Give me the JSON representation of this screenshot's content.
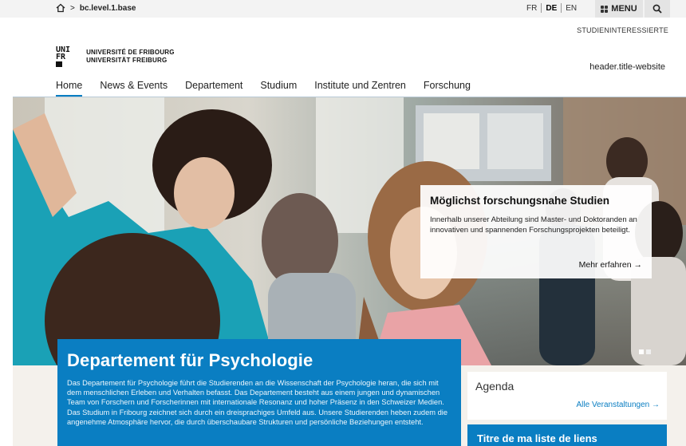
{
  "topbar": {
    "breadcrumb_sep": ">",
    "breadcrumb": "bc.level.1.base",
    "languages": [
      {
        "code": "FR",
        "active": false
      },
      {
        "code": "DE",
        "active": true
      },
      {
        "code": "EN",
        "active": false
      }
    ],
    "menu_label": "MENU",
    "icons": {
      "home": "home-icon",
      "menu": "grid-icon",
      "search": "search-icon"
    }
  },
  "header": {
    "audience_link": "STUDIENINTERESSIERTE",
    "logo_lines": [
      "UNI",
      "FR"
    ],
    "university_fr": "UNIVERSITÉ DE FRIBOURG",
    "university_de": "UNIVERSITÄT FREIBURG",
    "site_title": "header.title-website"
  },
  "nav": {
    "items": [
      "Home",
      "News & Events",
      "Departement",
      "Studium",
      "Institute und Zentren",
      "Forschung"
    ],
    "active_index": 0
  },
  "hero": {
    "teaser_title": "Möglichst forschungsnahe Studien",
    "teaser_text": "Innerhalb unserer Abteilung sind Master- und Doktoranden an innovativen und spannenden Forschungsprojekten beteiligt.",
    "teaser_link": "Mehr erfahren →",
    "slide_count": 2,
    "active_slide": 1
  },
  "intro": {
    "title": "Departement für Psychologie",
    "text": "Das Departement für Psychologie führt die Studierenden an die Wissenschaft der Psychologie heran, die sich mit dem menschlichen Erleben und Verhalten befasst. Das Departement besteht aus einem jungen und dynamischen Team von Forschern und Forscherinnen mit internationale Resonanz und hoher Präsenz in den Schweizer Medien. Das Studium in Fribourg zeichnet sich durch ein dreisprachiges Umfeld aus. Unsere Studierenden heben zudem die angenehme Atmosphäre hervor, die durch überschaubare Strukturen und persönliche Beziehungen entsteht."
  },
  "agenda": {
    "title": "Agenda",
    "all_link": "Alle Veranstaltungen →"
  },
  "links_box": {
    "title": "Titre de ma liste de liens"
  },
  "colors": {
    "brand_blue": "#0a7ec2",
    "topbar_bg": "#f3f3f3",
    "lower_bg": "#f4f1ec"
  }
}
